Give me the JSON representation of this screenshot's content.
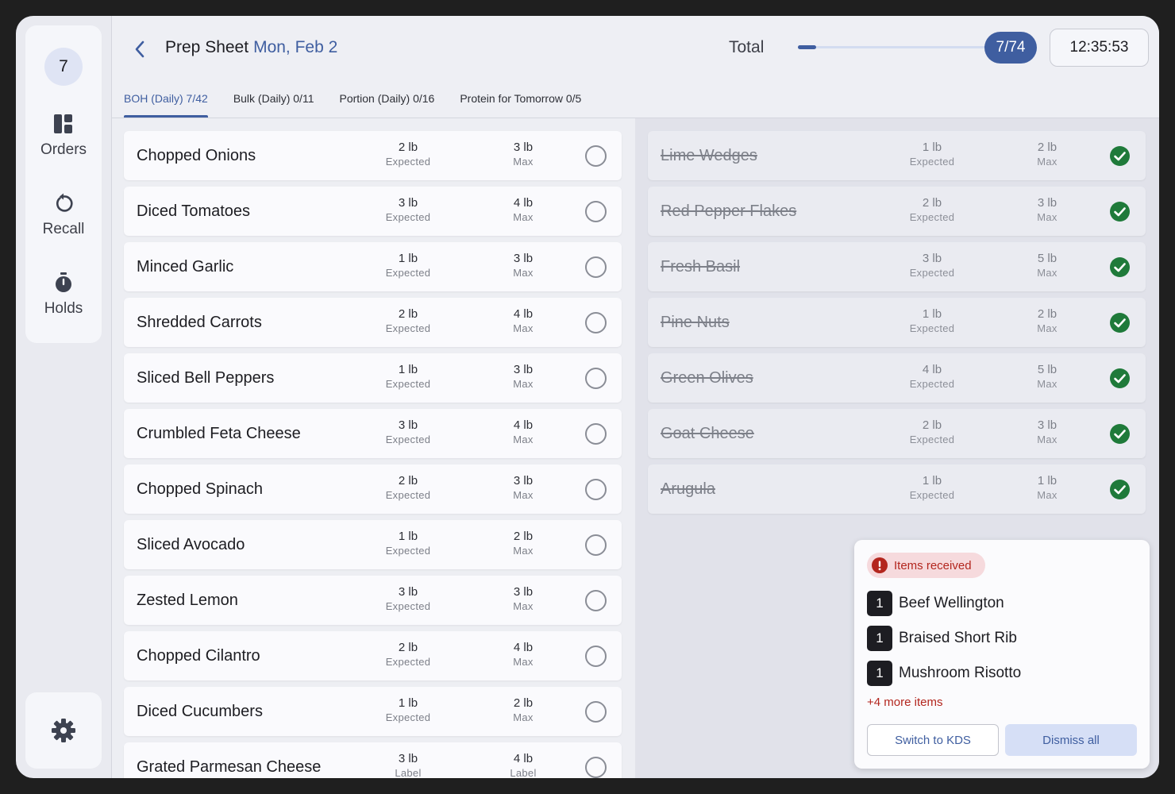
{
  "rail": {
    "badge": "7",
    "items": [
      {
        "label": "Orders",
        "icon": "orders-icon"
      },
      {
        "label": "Recall",
        "icon": "recall-icon"
      },
      {
        "label": "Holds",
        "icon": "timer-icon"
      }
    ],
    "settings_icon": "gear-icon"
  },
  "header": {
    "title": "Prep Sheet",
    "date": "Mon, Feb 2",
    "total_label": "Total",
    "progress_fraction": 0.0946,
    "count": "7/74",
    "clock": "12:35:53",
    "tabs": [
      {
        "label": "BOH (Daily) 7/42",
        "active": true
      },
      {
        "label": "Bulk (Daily) 0/11",
        "active": false
      },
      {
        "label": "Portion (Daily) 0/16",
        "active": false
      },
      {
        "label": "Protein for Tomorrow 0/5",
        "active": false
      }
    ]
  },
  "pending": [
    {
      "name": "Chopped Onions",
      "expected": "2 lb",
      "expected_sub": "Expected",
      "max": "3 lb",
      "max_sub": "Max"
    },
    {
      "name": "Diced Tomatoes",
      "expected": "3 lb",
      "expected_sub": "Expected",
      "max": "4 lb",
      "max_sub": "Max"
    },
    {
      "name": "Minced Garlic",
      "expected": "1 lb",
      "expected_sub": "Expected",
      "max": "3 lb",
      "max_sub": "Max"
    },
    {
      "name": "Shredded Carrots",
      "expected": "2 lb",
      "expected_sub": "Expected",
      "max": "4 lb",
      "max_sub": "Max"
    },
    {
      "name": "Sliced Bell Peppers",
      "expected": "1 lb",
      "expected_sub": "Expected",
      "max": "3 lb",
      "max_sub": "Max"
    },
    {
      "name": "Crumbled Feta Cheese",
      "expected": "3 lb",
      "expected_sub": "Expected",
      "max": "4 lb",
      "max_sub": "Max"
    },
    {
      "name": "Chopped Spinach",
      "expected": "2 lb",
      "expected_sub": "Expected",
      "max": "3 lb",
      "max_sub": "Max"
    },
    {
      "name": "Sliced Avocado",
      "expected": "1 lb",
      "expected_sub": "Expected",
      "max": "2 lb",
      "max_sub": "Max"
    },
    {
      "name": "Zested Lemon",
      "expected": "3 lb",
      "expected_sub": "Expected",
      "max": "3 lb",
      "max_sub": "Max"
    },
    {
      "name": "Chopped Cilantro",
      "expected": "2 lb",
      "expected_sub": "Expected",
      "max": "4 lb",
      "max_sub": "Max"
    },
    {
      "name": "Diced Cucumbers",
      "expected": "1 lb",
      "expected_sub": "Expected",
      "max": "2 lb",
      "max_sub": "Max"
    },
    {
      "name": "Grated Parmesan Cheese",
      "expected": "3 lb",
      "expected_sub": "Label",
      "max": "4 lb",
      "max_sub": "Label"
    }
  ],
  "completed": [
    {
      "name": "Lime Wedges",
      "expected": "1 lb",
      "expected_sub": "Expected",
      "max": "2 lb",
      "max_sub": "Max"
    },
    {
      "name": "Red Pepper Flakes",
      "expected": "2 lb",
      "expected_sub": "Expected",
      "max": "3 lb",
      "max_sub": "Max"
    },
    {
      "name": "Fresh Basil",
      "expected": "3 lb",
      "expected_sub": "Expected",
      "max": "5 lb",
      "max_sub": "Max"
    },
    {
      "name": "Pine Nuts",
      "expected": "1 lb",
      "expected_sub": "Expected",
      "max": "2 lb",
      "max_sub": "Max"
    },
    {
      "name": "Green Olives",
      "expected": "4 lb",
      "expected_sub": "Expected",
      "max": "5 lb",
      "max_sub": "Max"
    },
    {
      "name": "Goat Cheese",
      "expected": "2 lb",
      "expected_sub": "Expected",
      "max": "3 lb",
      "max_sub": "Max"
    },
    {
      "name": "Arugula",
      "expected": "1 lb",
      "expected_sub": "Expected",
      "max": "1 lb",
      "max_sub": "Max"
    }
  ],
  "notification": {
    "title": "Items received",
    "items": [
      {
        "qty": "1",
        "name": "Beef Wellington"
      },
      {
        "qty": "1",
        "name": "Braised Short Rib"
      },
      {
        "qty": "1",
        "name": "Mushroom Risotto"
      }
    ],
    "more": "+4 more items",
    "switch_label": "Switch to KDS",
    "dismiss_label": "Dismiss all"
  },
  "colors": {
    "accent": "#3f5ea0",
    "done_green": "#1f7a3a",
    "alert_red": "#b3261e"
  }
}
